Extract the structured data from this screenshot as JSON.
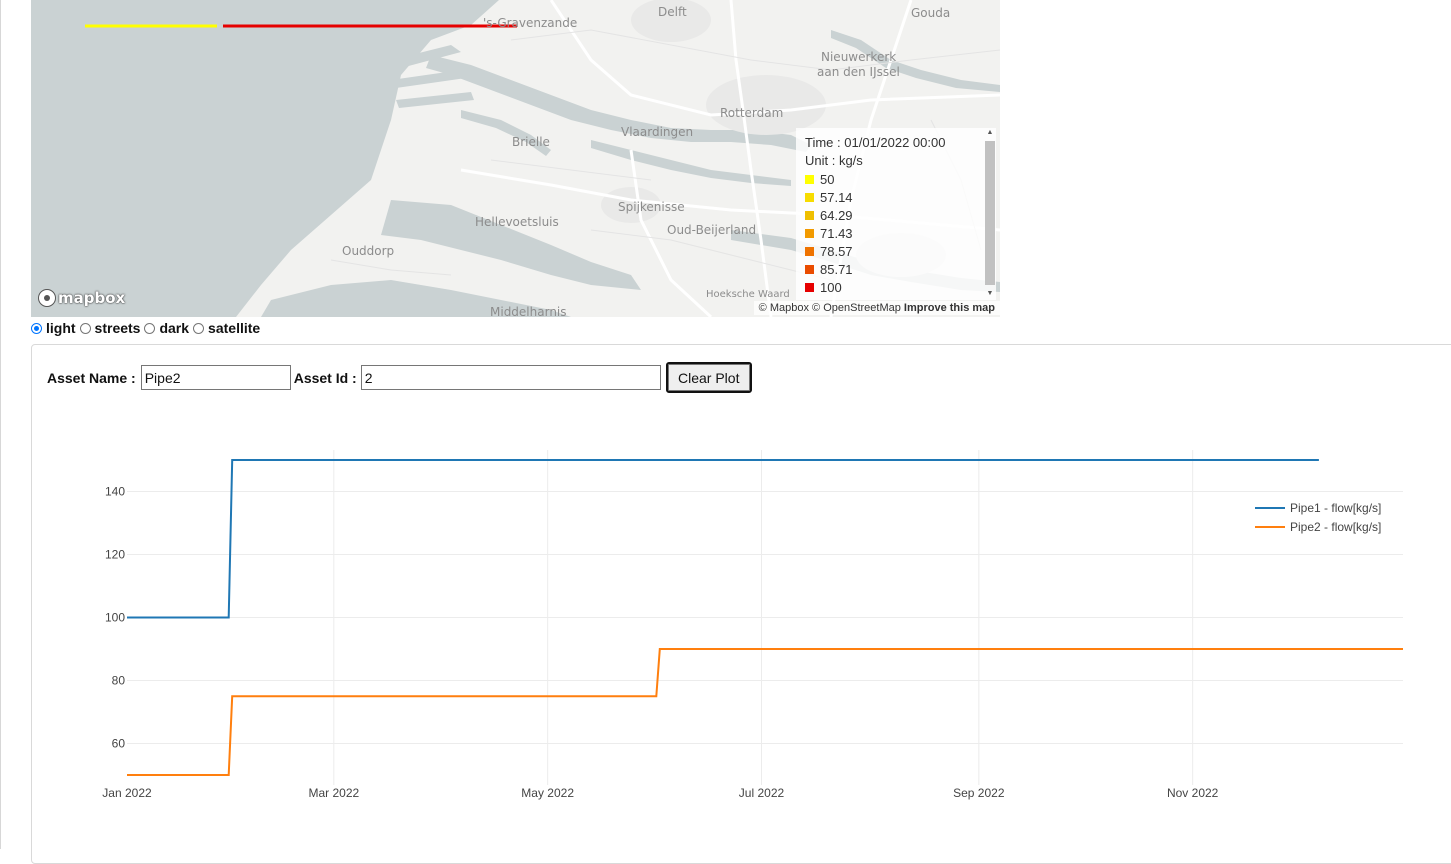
{
  "map": {
    "logo_text": "mapbox",
    "places": [
      {
        "name": "Delft",
        "cls": "mid"
      },
      {
        "name": "Gouda",
        "cls": ""
      },
      {
        "name": "'s-Gravenzande",
        "cls": ""
      },
      {
        "name": "Nieuwerkerk",
        "cls": ""
      },
      {
        "name": "aan den IJssel",
        "cls": ""
      },
      {
        "name": "Rotterdam",
        "cls": "big"
      },
      {
        "name": "Brielle",
        "cls": ""
      },
      {
        "name": "Vlaardingen",
        "cls": "mid"
      },
      {
        "name": "Spijkenisse",
        "cls": ""
      },
      {
        "name": "Hellevoetsluis",
        "cls": ""
      },
      {
        "name": "Oud-Beijerland",
        "cls": ""
      },
      {
        "name": "Ouddorp",
        "cls": ""
      },
      {
        "name": "Hoeksche Waard",
        "cls": ""
      },
      {
        "name": "Middelharnis",
        "cls": ""
      }
    ],
    "attribution": {
      "mapbox": "© Mapbox",
      "osm": "© OpenStreetMap",
      "improve": "Improve this map"
    },
    "legend": {
      "time_label": "Time : 01/01/2022 00:00",
      "unit_label": "Unit : kg/s",
      "entries": [
        {
          "value": "50",
          "color": "#ffff00"
        },
        {
          "value": "57.14",
          "color": "#f7dc00"
        },
        {
          "value": "64.29",
          "color": "#efbf00"
        },
        {
          "value": "71.43",
          "color": "#f29a00"
        },
        {
          "value": "78.57",
          "color": "#ef7300"
        },
        {
          "value": "85.71",
          "color": "#ea4c00"
        },
        {
          "value": "100",
          "color": "#e60000"
        }
      ]
    },
    "pipe_colors": {
      "pipe1": "#ffff00",
      "pipe2": "#e60000"
    }
  },
  "map_styles": {
    "selected": "light",
    "options": [
      "light",
      "streets",
      "dark",
      "satellite"
    ]
  },
  "form": {
    "asset_name_label": "Asset Name :",
    "asset_name_value": "Pipe2",
    "asset_id_label": "Asset Id :",
    "asset_id_value": "2",
    "clear_button": "Clear Plot"
  },
  "chart_data": {
    "type": "line",
    "x_tick_labels": [
      "Jan 2022",
      "Mar 2022",
      "May 2022",
      "Jul 2022",
      "Sep 2022",
      "Nov 2022"
    ],
    "y_ticks": [
      60,
      80,
      100,
      120,
      140
    ],
    "ylim": [
      50,
      150
    ],
    "grid": true,
    "legend_position": "top-right",
    "series": [
      {
        "name": "Pipe1 - flow[kg/s]",
        "color": "#1f77b4",
        "points": [
          [
            "2022-01-01",
            100
          ],
          [
            "2022-01-30",
            100
          ],
          [
            "2022-01-31",
            150
          ],
          [
            "2022-12-07",
            150
          ]
        ]
      },
      {
        "name": "Pipe2 - flow[kg/s]",
        "color": "#ff7f0e",
        "points": [
          [
            "2022-01-01",
            50
          ],
          [
            "2022-01-30",
            50
          ],
          [
            "2022-01-31",
            75
          ],
          [
            "2022-06-01",
            75
          ],
          [
            "2022-06-02",
            90
          ],
          [
            "2022-12-31",
            90
          ]
        ]
      }
    ]
  }
}
